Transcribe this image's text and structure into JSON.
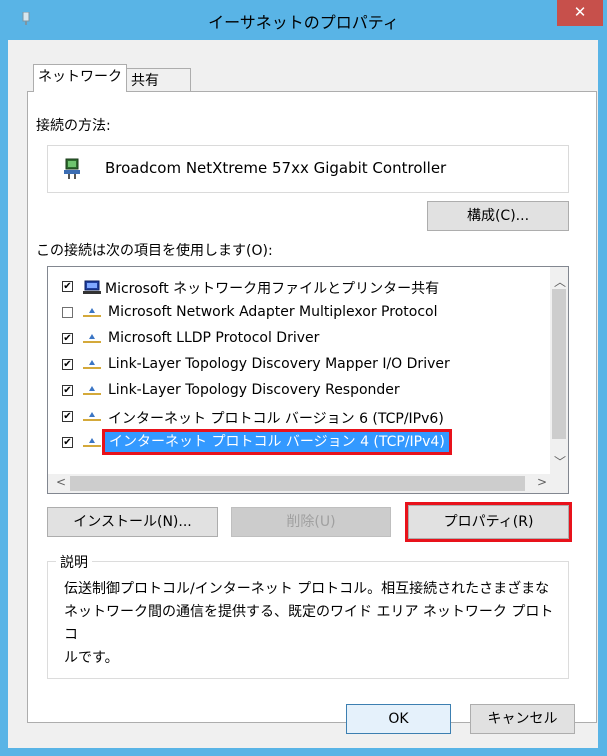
{
  "window": {
    "title": "イーサネットのプロパティ",
    "close_glyph": "✕"
  },
  "tabs": [
    {
      "label": "ネットワーク"
    },
    {
      "label": "共有"
    }
  ],
  "connect_using_label": "接続の方法:",
  "adapter_name": "Broadcom NetXtreme 57xx Gigabit Controller",
  "configure_label": "構成(C)...",
  "items_label": "この接続は次の項目を使用します(O):",
  "items": [
    {
      "label": "Microsoft ネットワーク用ファイルとプリンター共有",
      "checked": true,
      "icon": "network-share-icon"
    },
    {
      "label": "Microsoft Network Adapter Multiplexor Protocol",
      "checked": false,
      "icon": "protocol-icon"
    },
    {
      "label": "Microsoft LLDP Protocol Driver",
      "checked": true,
      "icon": "protocol-icon"
    },
    {
      "label": "Link-Layer Topology Discovery Mapper I/O Driver",
      "checked": true,
      "icon": "protocol-icon"
    },
    {
      "label": "Link-Layer Topology Discovery Responder",
      "checked": true,
      "icon": "protocol-icon"
    },
    {
      "label": "インターネット プロトコル バージョン 6 (TCP/IPv6)",
      "checked": true,
      "icon": "protocol-icon"
    },
    {
      "label": "インターネット プロトコル バージョン 4 (TCP/IPv4)",
      "checked": true,
      "icon": "protocol-icon",
      "selected": true
    }
  ],
  "buttons": {
    "install": "インストール(N)...",
    "uninstall": "削除(U)",
    "properties": "プロパティ(R)",
    "ok": "OK",
    "cancel": "キャンセル"
  },
  "description": {
    "title": "説明",
    "text_lines": [
      "伝送制御プロトコル/インターネット プロトコル。相互接続されたさまざまな",
      "ネットワーク間の通信を提供する、既定のワイド エリア ネットワーク プロトコ",
      "ルです。"
    ]
  },
  "colors": {
    "titlebar": "#59b4e6",
    "close": "#c7504b",
    "selection": "#3399ff",
    "highlight_box": "#e8121b"
  }
}
